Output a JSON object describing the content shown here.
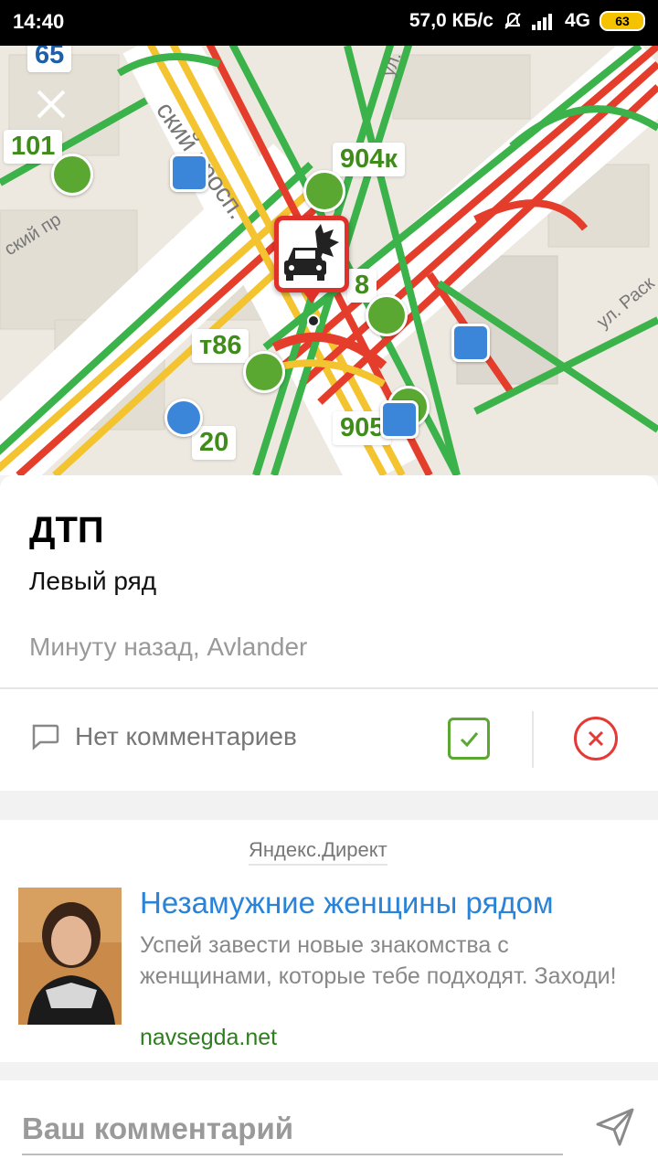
{
  "status_bar": {
    "time": "14:40",
    "network_speed": "57,0 КБ/с",
    "network_type": "4G",
    "battery": "63"
  },
  "map": {
    "street_labels": [
      "ский просп.",
      "ский пр",
      "ул.",
      "ул. Раск"
    ],
    "route_labels": [
      "65",
      "101",
      "904к",
      "8",
      "т86",
      "20",
      "905"
    ],
    "icons": [
      "close-icon",
      "car-crash-icon",
      "bus-stop-icon",
      "trolleybus-stop-icon"
    ]
  },
  "incident": {
    "title": "ДТП",
    "subtitle": "Левый ряд",
    "meta": "Минуту назад, Avlander",
    "comments_label": "Нет комментариев"
  },
  "ad": {
    "source": "Яндекс.Директ",
    "title": "Незамужние женщины рядом",
    "text": "Успей завести новые знакомства с женщинами, которые тебе подходят. Заходи!",
    "url": "navsegda.net"
  },
  "comment_input": {
    "placeholder": "Ваш комментарий"
  },
  "colors": {
    "traffic_green": "#3bb24a",
    "traffic_yellow": "#f4c430",
    "traffic_red": "#e53d2c",
    "accent_blue": "#2a83d6",
    "confirm_green": "#5aa832",
    "reject_red": "#e53935"
  }
}
